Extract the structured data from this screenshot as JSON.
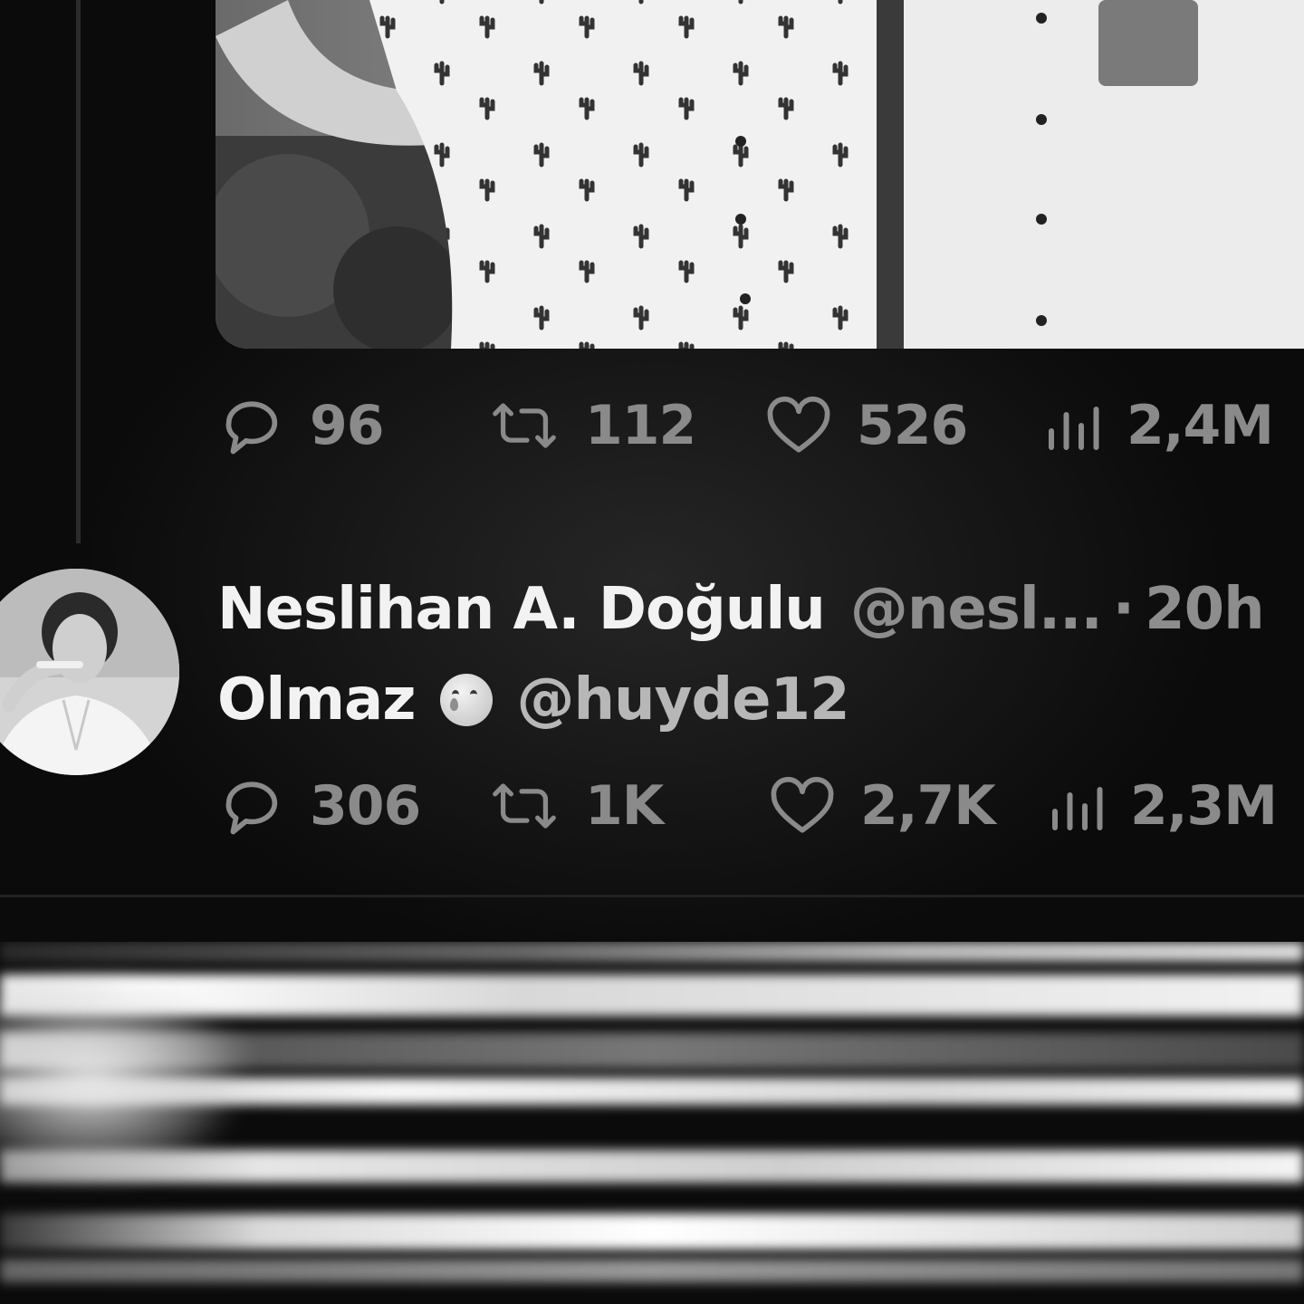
{
  "previous_tweet": {
    "media_alt": "photo",
    "actions": {
      "replies": "96",
      "reposts": "112",
      "likes": "526",
      "views": "2,4M"
    }
  },
  "tweet": {
    "display_name": "Neslihan A. Doğulu",
    "handle": "@nesl...",
    "separator": "·",
    "time": "20h",
    "body": "Olmaz",
    "emoji": "face-holding-back-tears",
    "mention": "@huyde12",
    "actions": {
      "replies": "306",
      "reposts": "1K",
      "likes": "2,7K",
      "views": "2,3M"
    }
  },
  "colors": {
    "background": "#0b0b0b",
    "primary_text": "#f2f2f2",
    "secondary_text": "#8d8d8d",
    "action_text": "#8a8a8a"
  }
}
